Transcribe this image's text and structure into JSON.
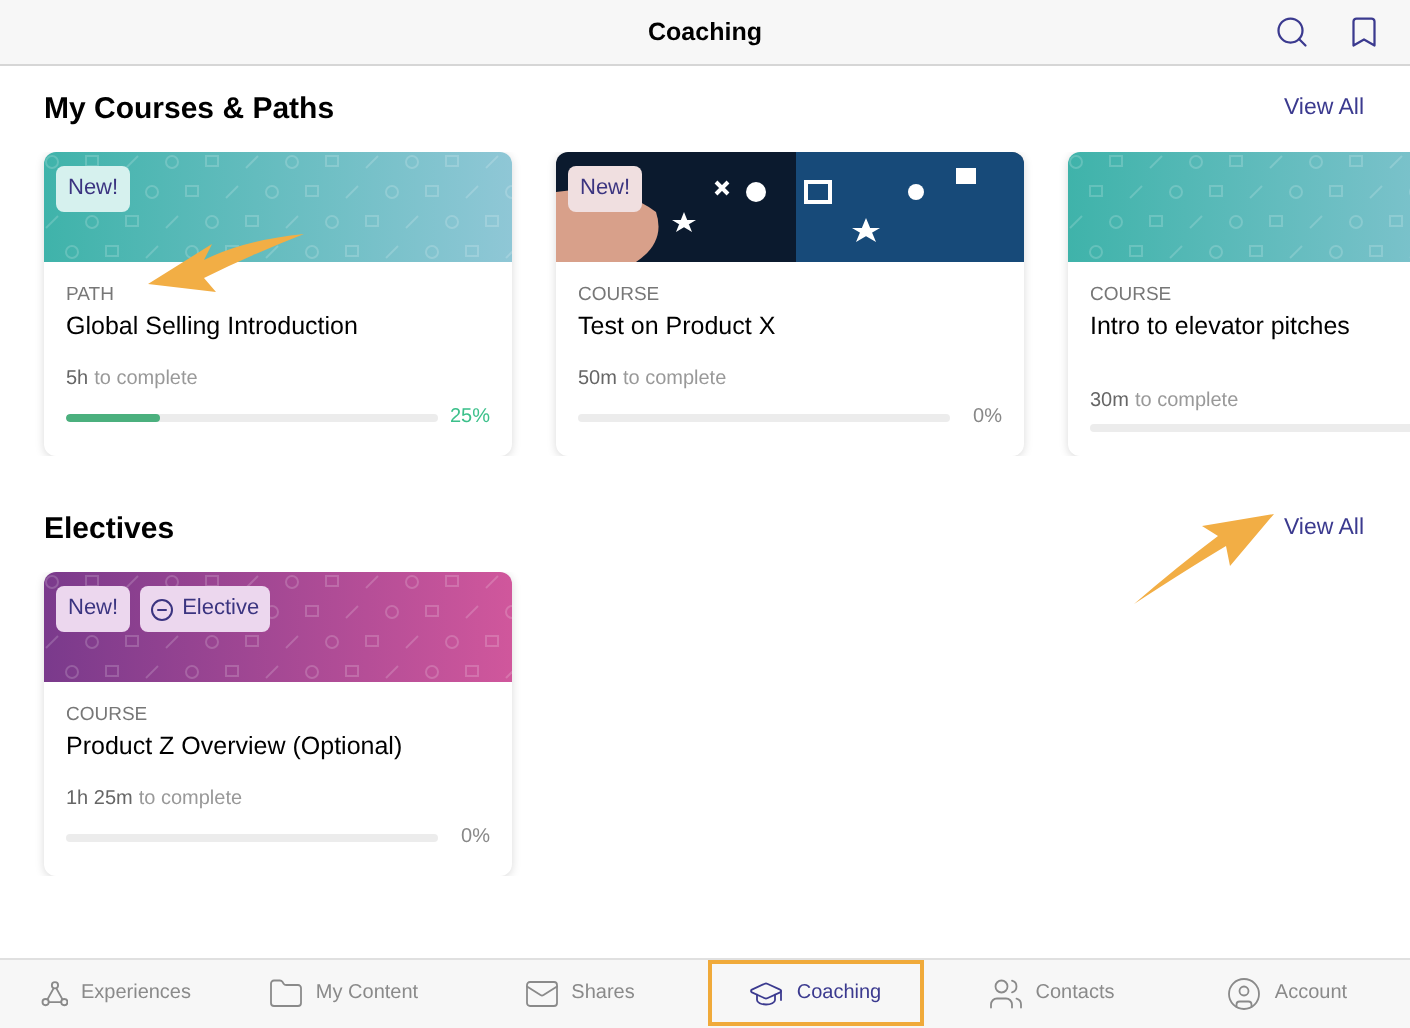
{
  "header": {
    "title": "Coaching"
  },
  "courses": {
    "title": "My Courses & Paths",
    "view_all": "View All",
    "cards": [
      {
        "kind": "teal",
        "badges": [
          {
            "kind": "new",
            "label": "New!"
          }
        ],
        "type": "PATH",
        "title": "Global Selling Introduction",
        "duration": "5h",
        "suffix": "to complete",
        "level": 0.25,
        "reading": "25%"
      },
      {
        "badges": [
          {
            "kind": "new",
            "label": "New!"
          }
        ],
        "type": "COURSE",
        "title": "Test on Product X",
        "duration": "50m",
        "suffix": "to complete",
        "level": 0,
        "reading": "0%"
      },
      {
        "kind": "teal",
        "type": "COURSE",
        "title": "Intro to elevator pitches",
        "duration": "30m",
        "suffix": "to complete",
        "level": 0
      }
    ]
  },
  "electives": {
    "title": "Electives",
    "view_all": "View All",
    "cards": [
      {
        "kind": "magenta",
        "badges": [
          {
            "kind": "new",
            "label": "New!"
          },
          {
            "kind": "elective",
            "label": "Elective"
          }
        ],
        "type": "COURSE",
        "title": "Product Z Overview (Optional)",
        "duration": "1h 25m",
        "suffix": "to complete",
        "level": 0,
        "reading": "0%"
      }
    ]
  },
  "tabs": [
    {
      "label": "Experiences",
      "selected": false
    },
    {
      "label": "My Content",
      "selected": false
    },
    {
      "label": "Shares",
      "selected": false
    },
    {
      "label": "Coaching",
      "selected": true
    },
    {
      "label": "Contacts",
      "selected": false
    },
    {
      "label": "Account",
      "selected": false
    }
  ]
}
